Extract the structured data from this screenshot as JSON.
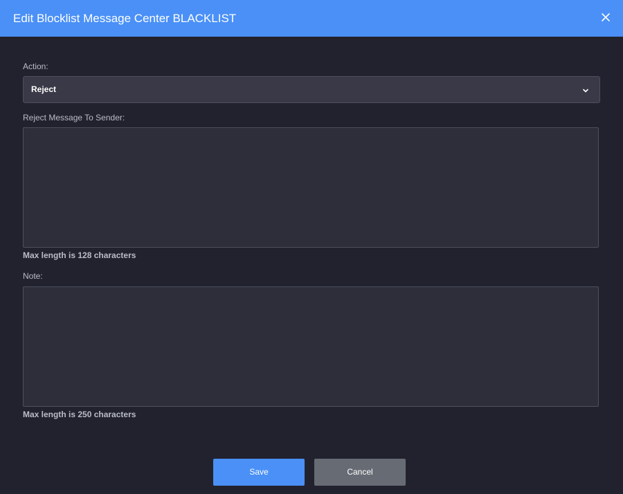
{
  "dialog": {
    "title": "Edit Blocklist Message Center BLACKLIST",
    "close_icon": "close-icon"
  },
  "action": {
    "label": "Action:",
    "selected": "Reject",
    "dropdown_icon": "chevron-down-icon"
  },
  "reject_message": {
    "label": "Reject Message To Sender:",
    "value": "",
    "hint": "Max length is 128 characters"
  },
  "note": {
    "label": "Note:",
    "value": "",
    "hint": "Max length is 250 characters"
  },
  "buttons": {
    "save": "Save",
    "cancel": "Cancel"
  },
  "colors": {
    "header": "#4a90f7",
    "background": "#22222e",
    "save_button": "#4a90f7",
    "cancel_button": "#676c74"
  }
}
